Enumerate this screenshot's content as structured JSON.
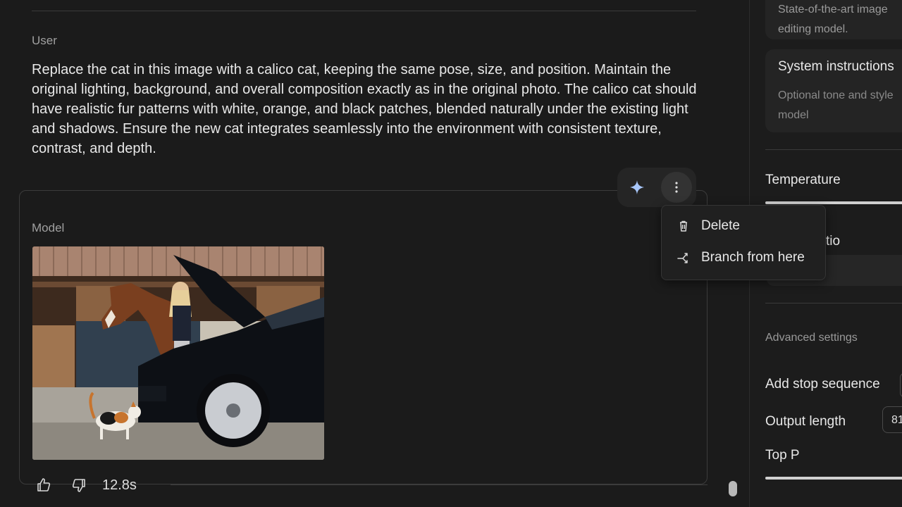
{
  "chat": {
    "user_role": "User",
    "user_message": "Replace the cat in this image with a calico cat, keeping the same pose, size, and position. Maintain the original lighting, background, and overall composition exactly as in the original photo. The calico cat should have realistic fur patterns with white, orange, and black patches, blended naturally under the existing light and shadows. Ensure the new cat integrates seamlessly into the environment with consistent texture, contrast, and depth.",
    "model_role": "Model",
    "response_time": "12.8s"
  },
  "context_menu": {
    "items": [
      {
        "label": "Delete",
        "icon": "trash-icon"
      },
      {
        "label": "Branch from here",
        "icon": "branch-icon"
      }
    ]
  },
  "settings": {
    "model_description": "State-of-the-art image\nediting model.",
    "system_instructions_title": "System instructions",
    "system_instructions_placeholder": "Optional tone and style\nmodel",
    "temperature_label": "Temperature",
    "aspect_ratio_label_visible": "tio",
    "advanced_settings_label": "Advanced settings",
    "stop_sequence_label": "Add stop sequence",
    "output_length_label": "Output length",
    "output_length_value": "81",
    "top_p_label": "Top P"
  },
  "colors": {
    "background": "#1b1b1b",
    "accent_sparkle": "#a8c7fa"
  }
}
